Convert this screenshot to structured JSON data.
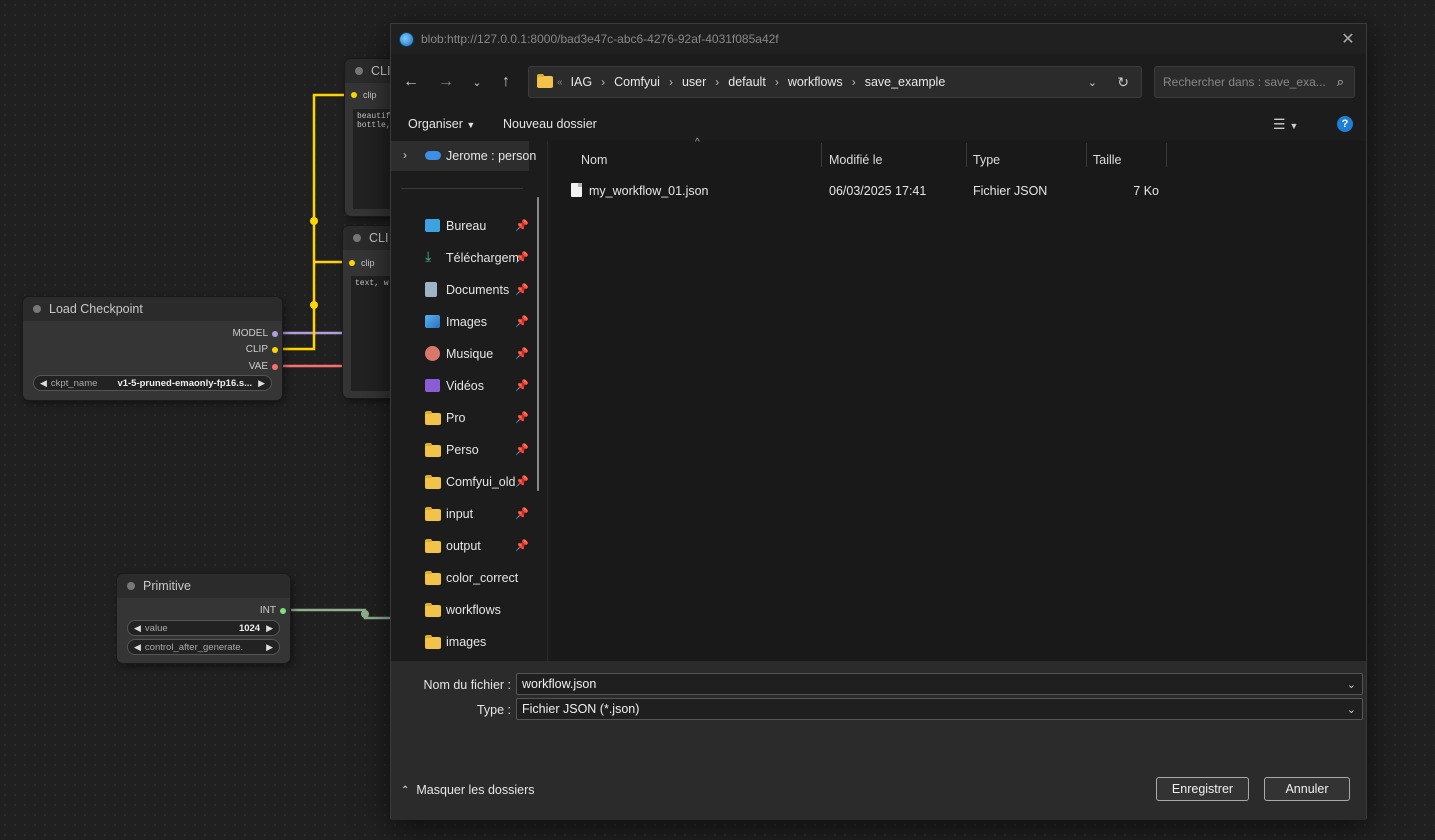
{
  "canvas": {
    "load_checkpoint": {
      "title": "Load Checkpoint",
      "outputs": [
        "MODEL",
        "CLIP",
        "VAE"
      ],
      "widget_label": "ckpt_name",
      "widget_value": "v1-5-pruned-emaonly-fp16.s..."
    },
    "clip_top": {
      "title": "CLI",
      "input": "clip",
      "text": "beautif\nbottle,"
    },
    "clip_bottom": {
      "title": "CLI",
      "input": "clip",
      "text": "text, w"
    },
    "primitive": {
      "title": "Primitive",
      "output": "INT",
      "value_label": "value",
      "value": "1024",
      "control_label": "control_after_generate."
    },
    "colors": {
      "model": "#b39ddb",
      "clip": "#ffd500",
      "vae": "#ff6e6e",
      "int": "#7fdf7f"
    }
  },
  "dialog": {
    "title": "blob:http://127.0.0.1:8000/bad3e47c-abc6-4276-92af-4031f085a42f",
    "breadcrumb_prefix": "«",
    "breadcrumbs": [
      "IAG",
      "Comfyui",
      "user",
      "default",
      "workflows",
      "save_example"
    ],
    "search_placeholder": "Rechercher dans : save_exa...",
    "organize_label": "Organiser",
    "new_folder_label": "Nouveau dossier",
    "nav": {
      "onedrive": "Jerome : person",
      "items": [
        {
          "label": "Bureau",
          "icon": "desktop-icon",
          "pinned": true
        },
        {
          "label": "Téléchargem",
          "icon": "download-icon",
          "pinned": true
        },
        {
          "label": "Documents",
          "icon": "documents-icon",
          "pinned": true
        },
        {
          "label": "Images",
          "icon": "pictures-icon",
          "pinned": true
        },
        {
          "label": "Musique",
          "icon": "music-icon",
          "pinned": true
        },
        {
          "label": "Vidéos",
          "icon": "videos-icon",
          "pinned": true
        },
        {
          "label": "Pro",
          "icon": "folder-icon",
          "pinned": true
        },
        {
          "label": "Perso",
          "icon": "folder-icon",
          "pinned": true
        },
        {
          "label": "Comfyui_old",
          "icon": "folder-icon",
          "pinned": true
        },
        {
          "label": "input",
          "icon": "folder-icon",
          "pinned": true
        },
        {
          "label": "output",
          "icon": "folder-icon",
          "pinned": true
        },
        {
          "label": "color_correct",
          "icon": "folder-icon",
          "pinned": false
        },
        {
          "label": "workflows",
          "icon": "folder-icon",
          "pinned": false
        },
        {
          "label": "images",
          "icon": "folder-icon",
          "pinned": false
        }
      ]
    },
    "columns": [
      "Nom",
      "Modifié le",
      "Type",
      "Taille"
    ],
    "files": [
      {
        "name": "my_workflow_01.json",
        "modified": "06/03/2025 17:41",
        "type": "Fichier JSON",
        "size": "7 Ko"
      }
    ],
    "filename_label": "Nom du fichier :",
    "filename_value": "workflow.json",
    "type_label": "Type :",
    "type_value": "Fichier JSON (*.json)",
    "hide_folders_label": "Masquer les dossiers",
    "save_label": "Enregistrer",
    "cancel_label": "Annuler"
  }
}
